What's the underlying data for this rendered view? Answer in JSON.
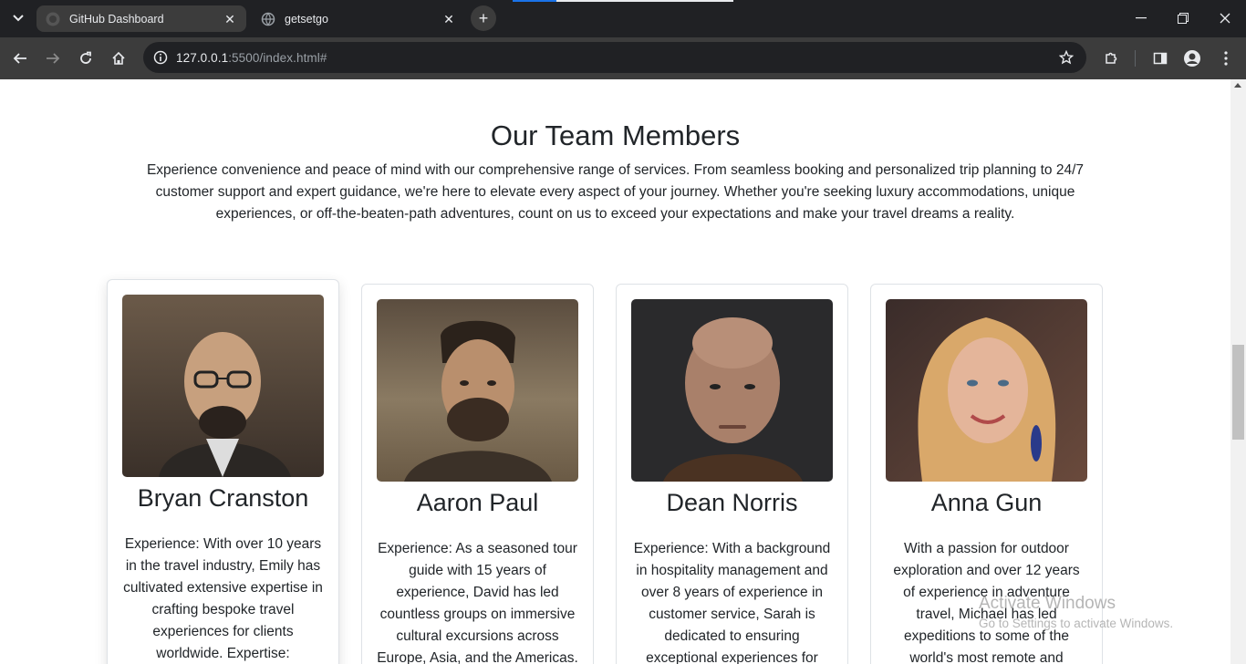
{
  "browser": {
    "tabs": [
      {
        "title": "GitHub Dashboard",
        "active": true,
        "icon": "github-icon"
      },
      {
        "title": "getsetgo",
        "active": false,
        "icon": "globe-icon"
      }
    ],
    "url_host": "127.0.0.1",
    "url_rest": ":5500/index.html#"
  },
  "page": {
    "section_title": "Our Team Members",
    "section_description": "Experience convenience and peace of mind with our comprehensive range of services. From seamless booking and personalized trip planning to 24/7 customer support and expert guidance, we're here to elevate every aspect of your journey. Whether you're seeking luxury accommodations, unique experiences, or off-the-beaten-path adventures, count on us to exceed your expectations and make your travel dreams a reality.",
    "members": [
      {
        "name": "Bryan Cranston",
        "description": "Experience: With over 10 years in the travel industry, Emily has cultivated extensive expertise in crafting bespoke travel experiences for clients worldwide. Expertise:"
      },
      {
        "name": "Aaron Paul",
        "description": "Experience: As a seasoned tour guide with 15 years of experience, David has led countless groups on immersive cultural excursions across Europe, Asia, and the Americas."
      },
      {
        "name": "Dean Norris",
        "description": "Experience: With a background in hospitality management and over 8 years of experience in customer service, Sarah is dedicated to ensuring exceptional experiences for"
      },
      {
        "name": "Anna Gun",
        "description": "With a passion for outdoor exploration and over 12 years of experience in adventure travel, Michael has led expeditions to some of the world's most remote and"
      }
    ]
  },
  "os_watermark": {
    "line1": "Activate Windows",
    "line2": "Go to Settings to activate Windows."
  }
}
